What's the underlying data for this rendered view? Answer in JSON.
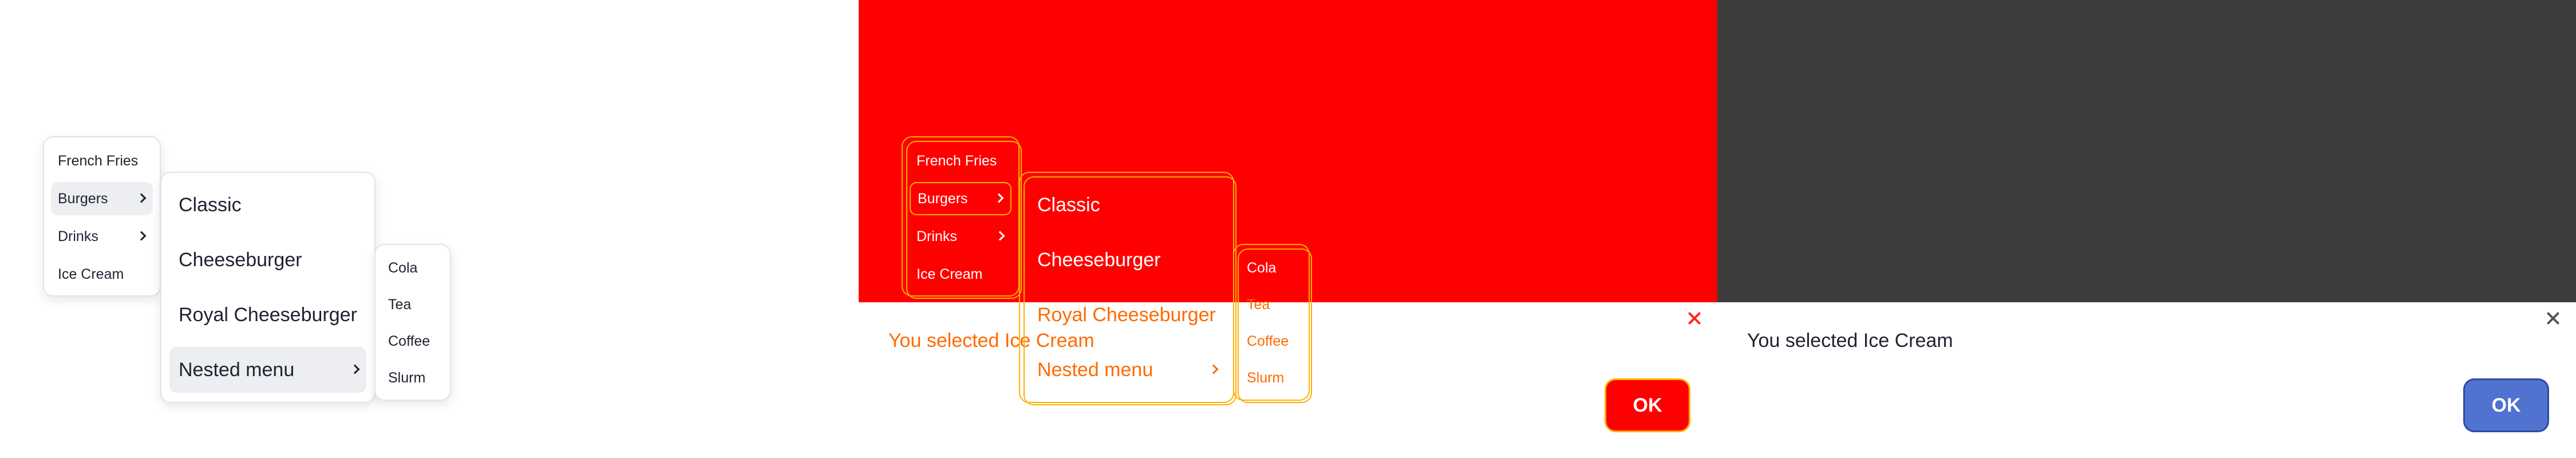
{
  "menu": {
    "items": [
      {
        "label": "French Fries"
      },
      {
        "label": "Burgers"
      },
      {
        "label": "Drinks"
      },
      {
        "label": "Ice Cream"
      }
    ],
    "burgers": [
      {
        "label": "Classic"
      },
      {
        "label": "Cheeseburger"
      },
      {
        "label": "Royal Cheeseburger"
      },
      {
        "label": "Nested menu"
      }
    ],
    "drinks": [
      {
        "label": "Cola"
      },
      {
        "label": "Tea"
      },
      {
        "label": "Coffee"
      },
      {
        "label": "Slurm"
      }
    ]
  },
  "dialog": {
    "message": "You selected Ice Cream",
    "ok_label": "OK"
  },
  "themes": {
    "light": {
      "background": "#ffffff",
      "text": "#1f2230",
      "active_item": "#eceef2"
    },
    "high_contrast": {
      "background": "#ff0000",
      "outline": "#ffb000",
      "text": "#ffffff",
      "accent_text": "#ff6a00"
    },
    "dark": {
      "background": "#3d3d3d",
      "button": "#5072d0"
    }
  }
}
